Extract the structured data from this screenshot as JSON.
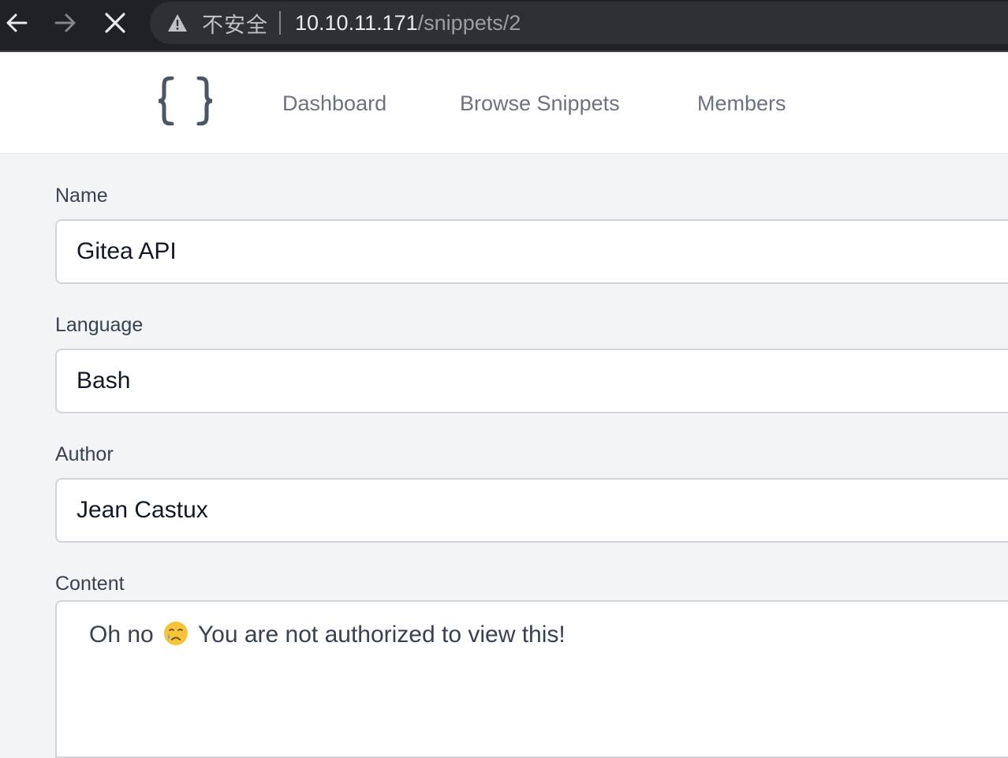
{
  "browser": {
    "back_icon": "arrow-left-icon",
    "forward_icon": "arrow-right-icon",
    "stop_icon": "close-icon",
    "security_icon": "warning-triangle-icon",
    "security_label": "不安全",
    "url_host": "10.10.11.171",
    "url_path": "/snippets/2"
  },
  "header": {
    "logo_icon": "curly-braces-icon",
    "nav": {
      "dashboard": "Dashboard",
      "browse_snippets": "Browse Snippets",
      "members": "Members"
    }
  },
  "form": {
    "name_label": "Name",
    "name_value": "Gitea API",
    "language_label": "Language",
    "language_value": "Bash",
    "author_label": "Author",
    "author_value": "Jean Castux",
    "content_label": "Content",
    "content_prefix": "Oh no",
    "content_emoji": "crying-face-icon",
    "content_suffix": "You are not authorized to view this!"
  },
  "colors": {
    "chrome_bg": "#202124",
    "page_bg": "#f3f4f6",
    "nav_text": "#6b7280",
    "label_text": "#374151"
  }
}
